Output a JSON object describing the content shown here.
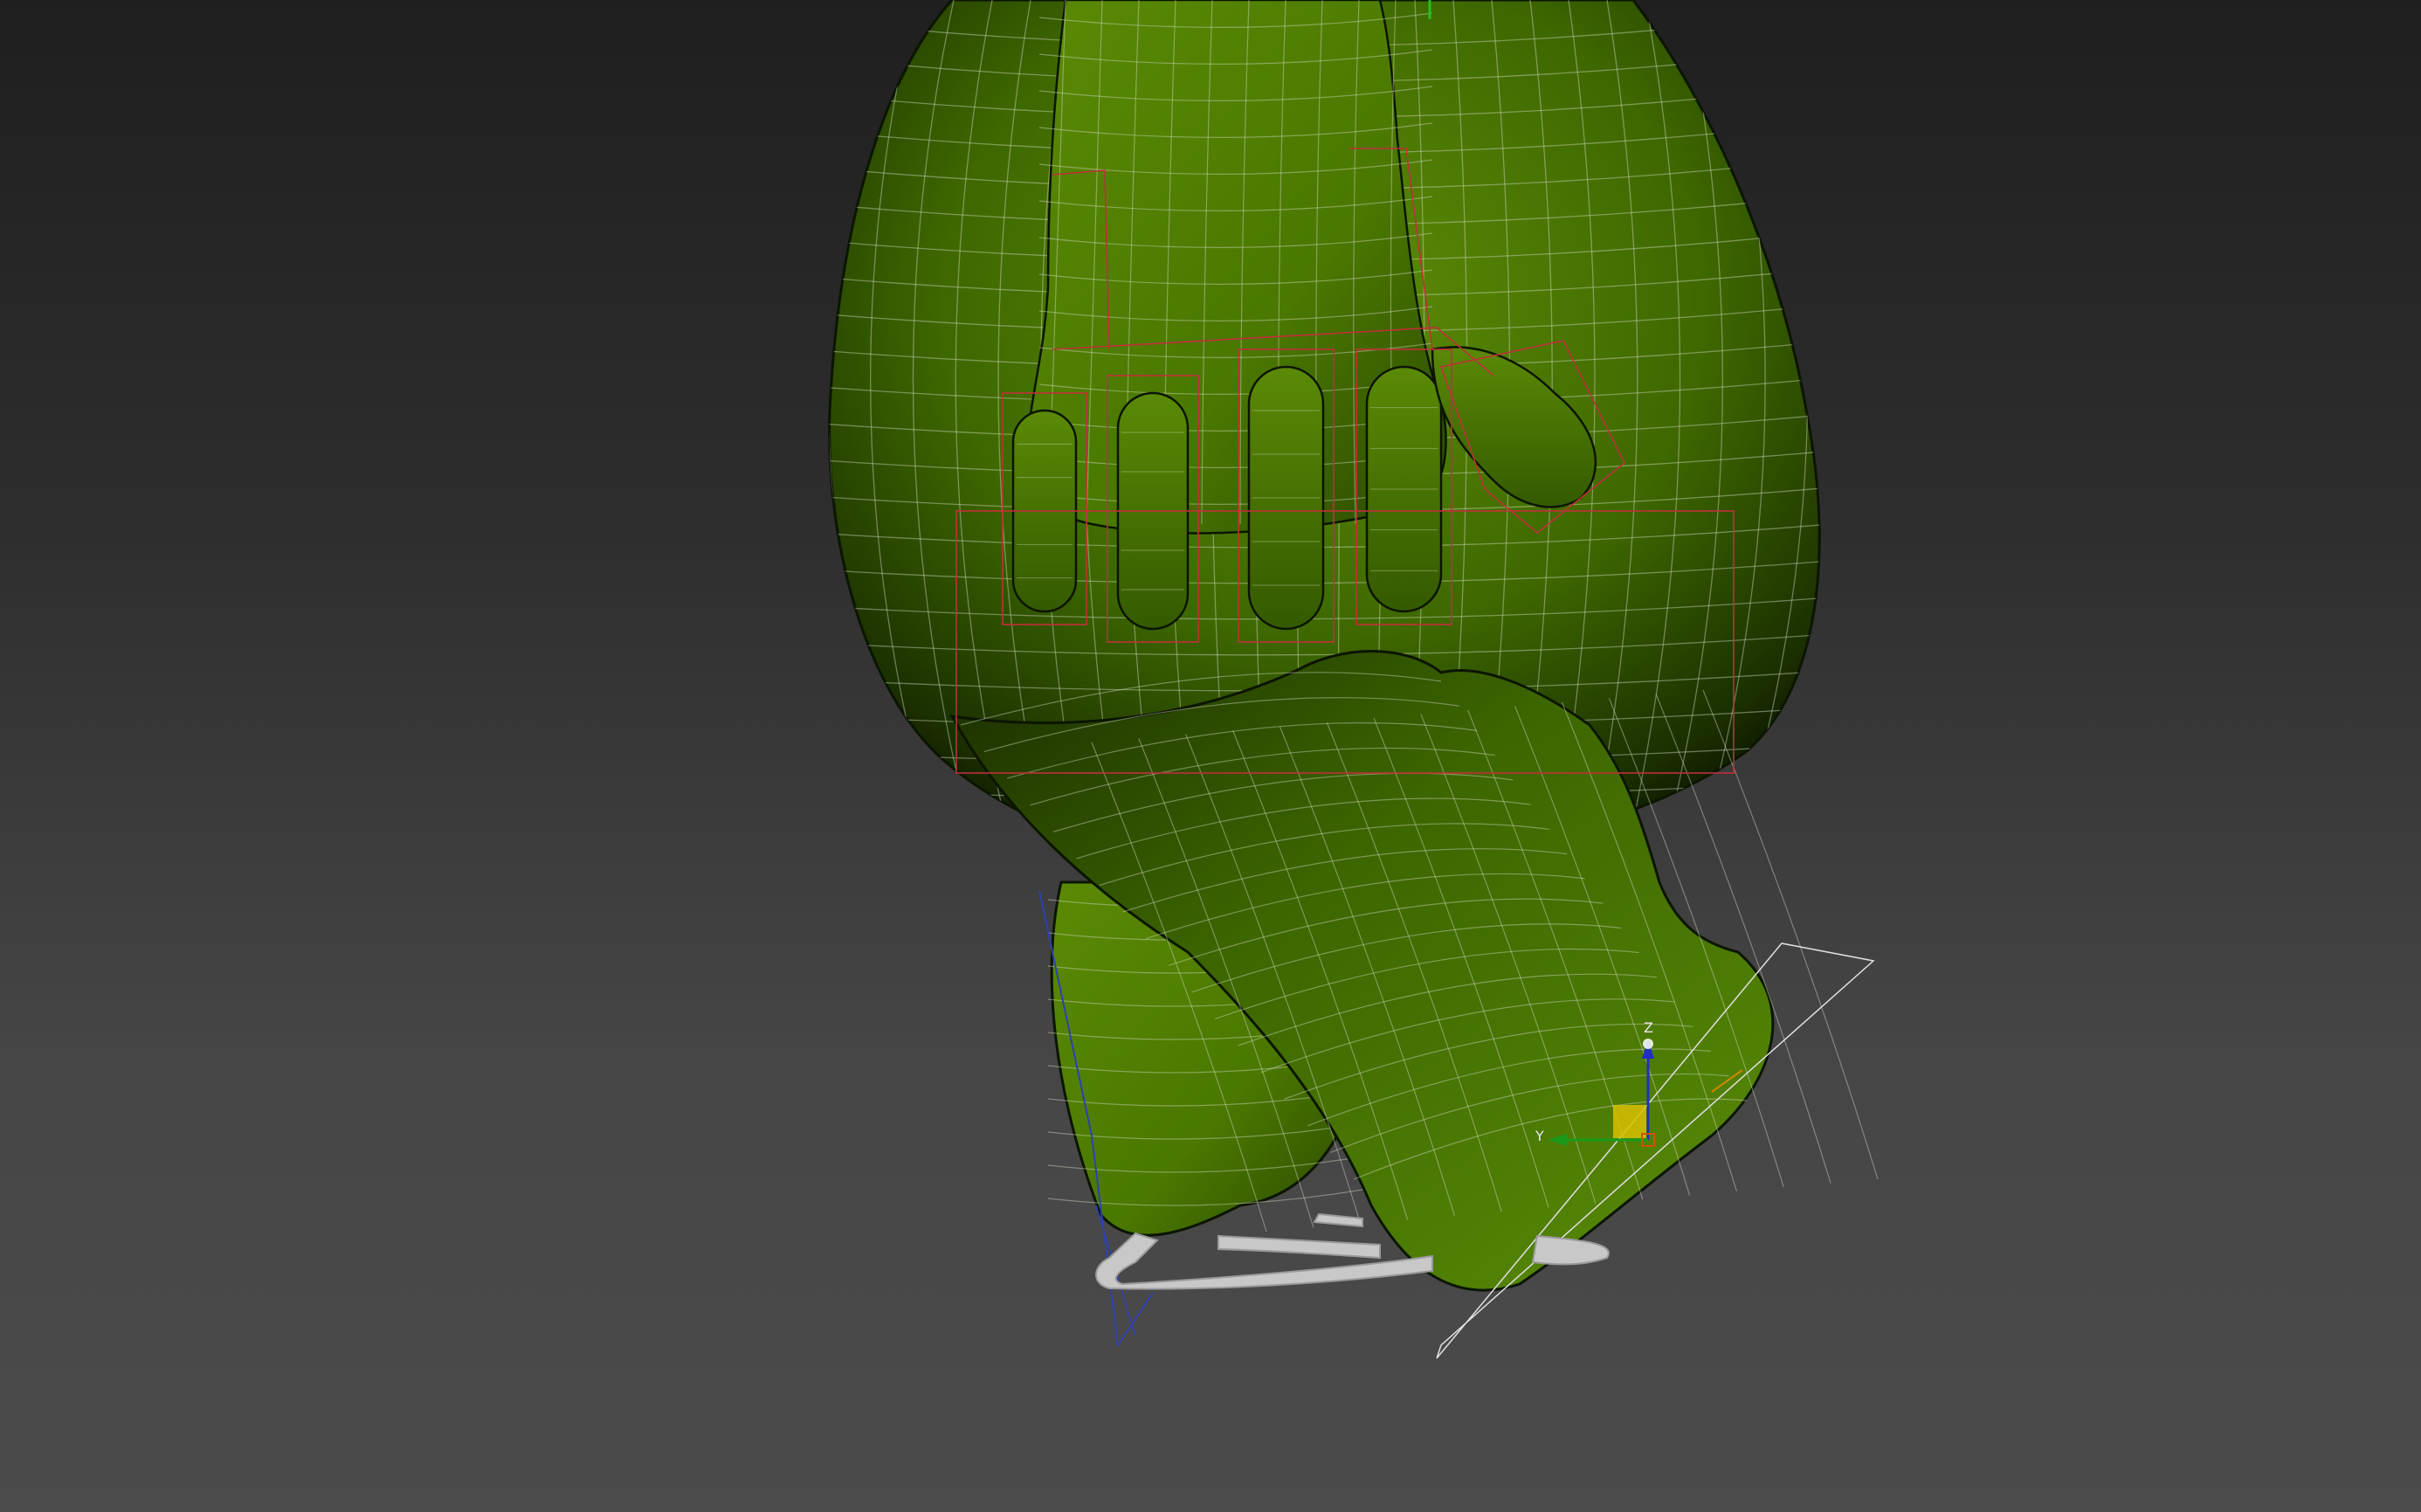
{
  "viewport": {
    "description_free": true,
    "background_top": "#1f1f1f",
    "background_bottom": "#4b4b4b"
  },
  "model": {
    "skin_color": "#4a7a00",
    "highlight_color": "#6a9a10",
    "shadow_color": "#0e1a00",
    "wire_color": "#cfd8c0"
  },
  "bones": {
    "color": "#c0303a",
    "finger_count": 5
  },
  "gizmo": {
    "x_axis_color": "#cc8800",
    "y_axis_color": "#1a9a1a",
    "z_axis_color": "#2030c0",
    "plane_color": "#d8c000",
    "z_label": "Z",
    "y_label": "Y"
  },
  "footstep_icons": {
    "color": "#d0d0d0"
  },
  "ground_plane": {
    "color": "#e0e0e0",
    "helper_color": "#3040b0"
  }
}
